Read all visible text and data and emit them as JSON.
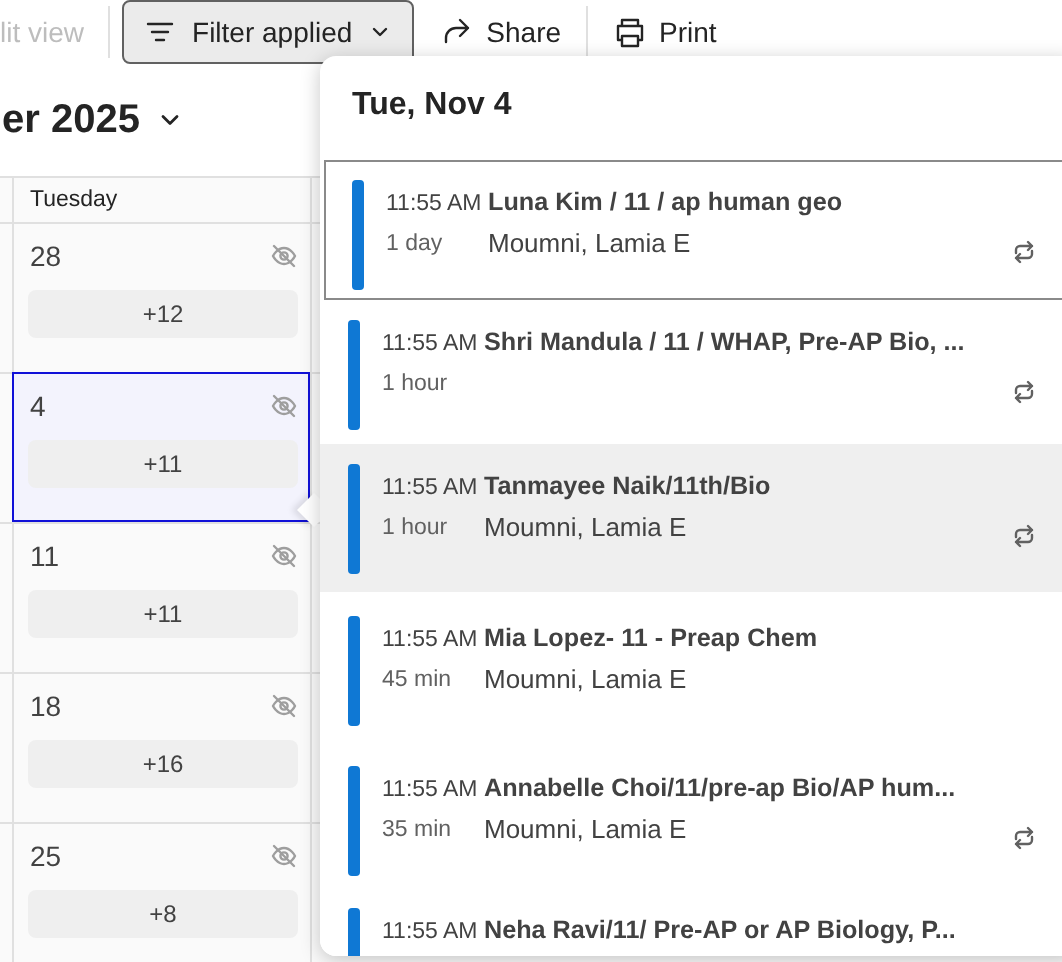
{
  "toolbar": {
    "items": [
      {
        "kind": "text",
        "label": "lit view",
        "disabled": true
      },
      {
        "kind": "filter",
        "label": "Filter applied",
        "selected": true
      },
      {
        "kind": "share",
        "label": "Share",
        "disabled": false
      },
      {
        "kind": "print",
        "label": "Print",
        "disabled": false
      }
    ]
  },
  "calendar": {
    "month_title": "er 2025",
    "column_header": "Tuesday",
    "weeks": [
      {
        "date": "28",
        "more": "+12",
        "selected": false
      },
      {
        "date": "4",
        "more": "+11",
        "selected": true
      },
      {
        "date": "11",
        "more": "+11",
        "selected": false
      },
      {
        "date": "18",
        "more": "+16",
        "selected": false
      },
      {
        "date": "25",
        "more": "+8",
        "selected": false
      }
    ]
  },
  "popup": {
    "title": "Tue, Nov 4",
    "events": [
      {
        "time": "11:55 AM",
        "duration": "1 day",
        "title": "Luna Kim / 11 / ap human geo",
        "organizer": "Moumni, Lamia E",
        "recurring": true,
        "focused": true,
        "hovered": false,
        "color": "#0f78d4"
      },
      {
        "time": "11:55 AM",
        "duration": "1 hour",
        "title": "Shri Mandula / 11 / WHAP, Pre-AP Bio, ...",
        "recurring": true,
        "focused": false,
        "hovered": false,
        "color": "#0f78d4"
      },
      {
        "time": "11:55 AM",
        "duration": "1 hour",
        "title": "Tanmayee Naik/11th/Bio",
        "organizer": "Moumni, Lamia E",
        "recurring": true,
        "focused": false,
        "hovered": true,
        "color": "#0f78d4"
      },
      {
        "time": "11:55 AM",
        "duration": "45 min",
        "title": "Mia Lopez- 11 - Preap Chem",
        "organizer": "Moumni, Lamia E",
        "recurring": false,
        "focused": false,
        "hovered": false,
        "color": "#0f78d4"
      },
      {
        "time": "11:55 AM",
        "duration": "35 min",
        "title": "Annabelle Choi/11/pre-ap Bio/AP hum...",
        "organizer": "Moumni, Lamia E",
        "recurring": true,
        "focused": false,
        "hovered": false,
        "color": "#0f78d4"
      },
      {
        "time": "11:55 AM",
        "title": "Neha Ravi/11/ Pre-AP or AP Biology, P...",
        "recurring": false,
        "focused": false,
        "hovered": false,
        "color": "#0f78d4"
      }
    ]
  }
}
